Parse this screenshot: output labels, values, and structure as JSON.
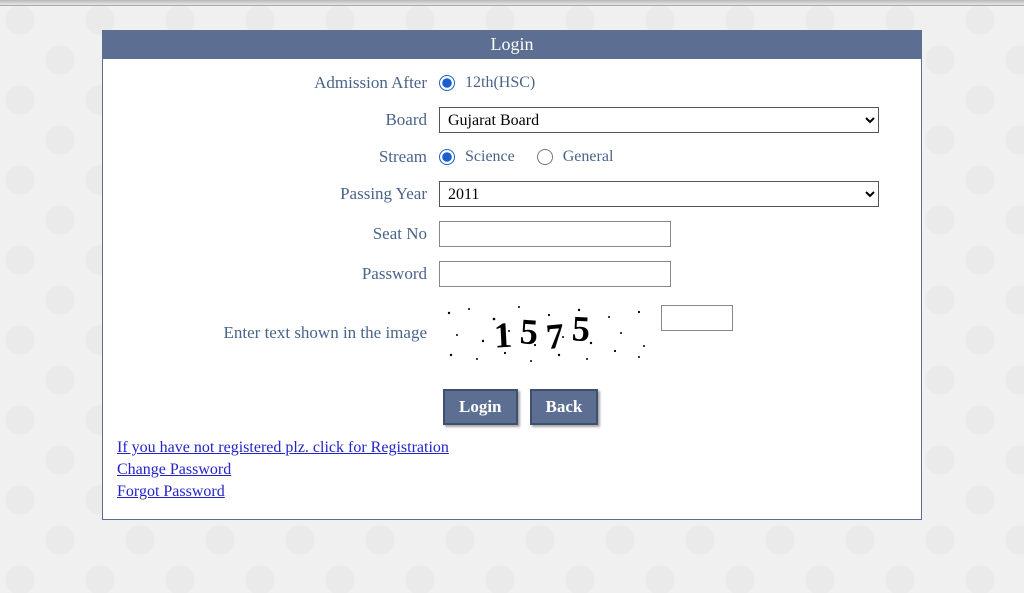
{
  "header": {
    "title": "Login"
  },
  "fields": {
    "admission_after": {
      "label": "Admission After",
      "option_label": "12th(HSC)",
      "checked": true
    },
    "board": {
      "label": "Board",
      "selected": "Gujarat Board"
    },
    "stream": {
      "label": "Stream",
      "options": {
        "science": {
          "label": "Science",
          "checked": true
        },
        "general": {
          "label": "General",
          "checked": false
        }
      }
    },
    "passing_year": {
      "label": "Passing Year",
      "selected": "2011"
    },
    "seat_no": {
      "label": "Seat No",
      "value": ""
    },
    "password": {
      "label": "Password",
      "value": ""
    },
    "captcha": {
      "label": "Enter text shown in the image",
      "image_text": "1575",
      "value": ""
    }
  },
  "buttons": {
    "login": "Login",
    "back": "Back"
  },
  "links": {
    "register": "If you have not registered plz. click for Registration",
    "change_password": "Change Password",
    "forgot_password": "Forgot Password"
  }
}
